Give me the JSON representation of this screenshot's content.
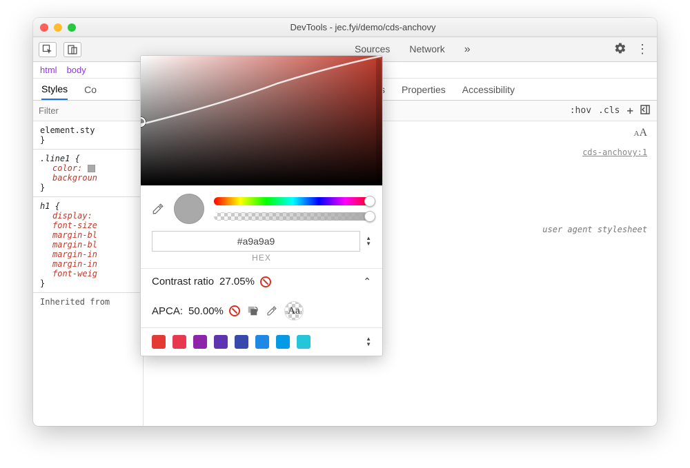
{
  "window": {
    "title": "DevTools - jec.fyi/demo/cds-anchovy"
  },
  "main_tabs": {
    "sources": "Sources",
    "network": "Network"
  },
  "crumbs": {
    "html": "html",
    "body": "body"
  },
  "subtabs": {
    "styles": "Styles",
    "co": "Co",
    "breakpoints": "Breakpoints",
    "properties": "Properties",
    "accessibility": "Accessibility"
  },
  "filter": {
    "placeholder": "Filter",
    "hov": ":hov",
    "cls": ".cls"
  },
  "styles_panel": {
    "element_style": "element.sty",
    "line1_selector": ".line1 {",
    "color_prop": "color:",
    "background_prop": "backgroun",
    "close1": "}",
    "h1_selector": "h1 {",
    "props": [
      "display:",
      "font-size",
      "margin-bl",
      "margin-bl",
      "margin-in",
      "margin-in",
      "font-weig"
    ],
    "close2": "}",
    "inherited": "Inherited from"
  },
  "right": {
    "aa": "AA",
    "source_link": "cds-anchovy:1",
    "ua": "user agent stylesheet"
  },
  "picker": {
    "hex_value": "#a9a9a9",
    "hex_label": "HEX",
    "contrast_label": "Contrast ratio",
    "contrast_value": "27.05%",
    "apca_label": "APCA:",
    "apca_value": "50.00%",
    "aa": "Aa",
    "swatches": [
      "#e53935",
      "#e8384f",
      "#8e24aa",
      "#5e35b1",
      "#3949ab",
      "#1e88e5",
      "#039be5",
      "#26c6da"
    ]
  }
}
